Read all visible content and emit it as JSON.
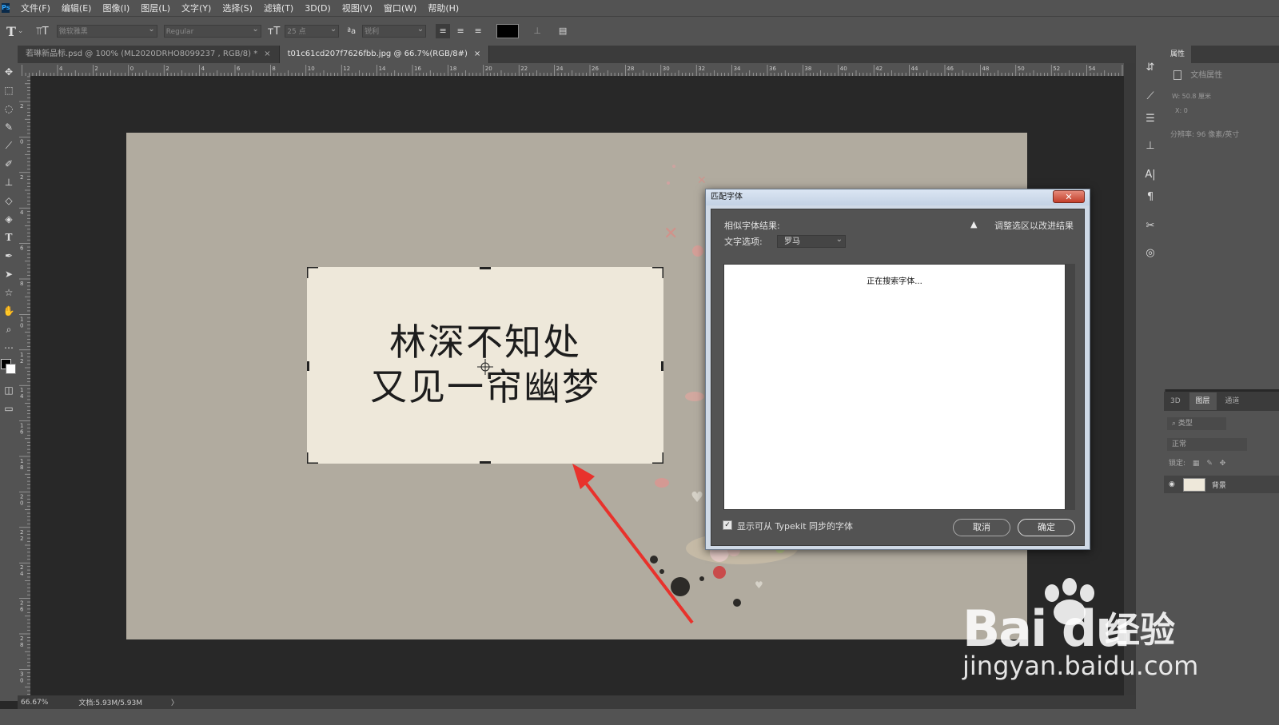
{
  "menubar": {
    "logo": "Ps",
    "items": [
      "文件(F)",
      "编辑(E)",
      "图像(I)",
      "图层(L)",
      "文字(Y)",
      "选择(S)",
      "滤镜(T)",
      "3D(D)",
      "视图(V)",
      "窗口(W)",
      "帮助(H)"
    ]
  },
  "options": {
    "font_family": "微软雅黑",
    "font_style": "Regular",
    "font_size": "25 点",
    "antialias": "锐利"
  },
  "tabs": [
    {
      "label": "若琳新品标.psd @ 100% (ML2020DRHO8099237 , RGB/8) *",
      "close": "×"
    },
    {
      "label": "t01c61cd207f7626fbb.jpg @ 66.7%(RGB/8#)",
      "close": "×"
    }
  ],
  "ruler": {
    "top_labels": [
      "4",
      "2",
      "0",
      "2",
      "4",
      "6",
      "8",
      "10",
      "12",
      "14",
      "16",
      "18",
      "20",
      "22",
      "24",
      "26",
      "28",
      "30",
      "32",
      "34",
      "36",
      "38",
      "40",
      "42",
      "44",
      "46",
      "48",
      "50",
      "52",
      "54"
    ],
    "left_labels": [
      "2",
      "0",
      "2",
      "4",
      "6",
      "8",
      "1 0",
      "1 2",
      "1 4",
      "1 6",
      "1 8",
      "2 0",
      "2 2",
      "2 4",
      "2 6",
      "2 8",
      "3 0"
    ]
  },
  "canvas": {
    "line1": "林深不知处",
    "line2": "又见一帘幽梦"
  },
  "status": {
    "zoom": "66.67%",
    "doc": "文档:5.93M/5.93M",
    "arrow": "〉"
  },
  "properties": {
    "tab": "属性",
    "doc_props": "文档属性",
    "w": "W:  50.8 厘米",
    "x": "X:  0",
    "resolution": "分辨率: 96 像素/英寸"
  },
  "layers": {
    "tabs": [
      "3D",
      "图层",
      "通道"
    ],
    "kind": "类型",
    "blend": "正常",
    "lock": "锁定:",
    "layer_name": "背景"
  },
  "dialog": {
    "title": "匹配字体",
    "close": "✕",
    "similar_label": "相似字体结果:",
    "warning": "调整选区以改进结果",
    "option_label": "文字选项:",
    "option_value": "罗马",
    "searching": "正在搜索字体...",
    "checkbox_label": "显示可从 Typekit 同步的字体",
    "cancel": "取消",
    "ok": "确定"
  },
  "watermark": {
    "logo": "Bai du",
    "cn": "经验",
    "url": "jingyan.baidu.com"
  },
  "colors": {
    "ui_dark": "#535353",
    "canvas_bg": "#b1ab9f",
    "textbox_bg": "#eee8da",
    "arrow": "#e8322c"
  }
}
